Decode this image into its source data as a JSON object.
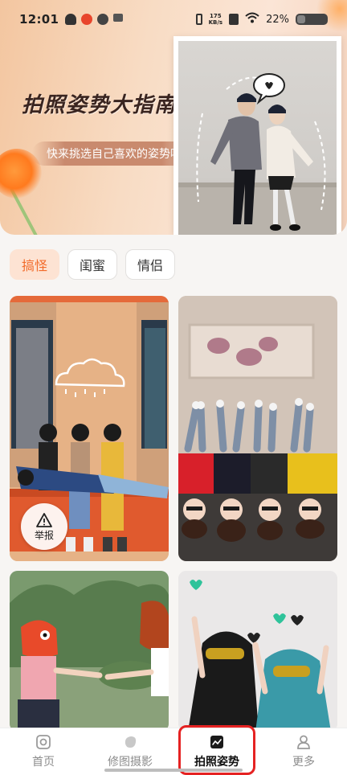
{
  "status": {
    "time": "12:01",
    "net_speed_top": "175",
    "net_speed_bottom": "KB/s",
    "battery": "22%"
  },
  "hero": {
    "title": "拍照姿势大指南",
    "subtitle": "快来挑选自己喜欢的姿势吧"
  },
  "tabs": [
    {
      "label": "搞怪",
      "active": true
    },
    {
      "label": "闺蜜",
      "active": false
    },
    {
      "label": "情侣",
      "active": false
    }
  ],
  "cards": {
    "report_label": "举报"
  },
  "bottom_nav": [
    {
      "label": "首页",
      "icon": "camera-square-icon",
      "active": false
    },
    {
      "label": "修图摄影",
      "icon": "edit-blob-icon",
      "active": false
    },
    {
      "label": "拍照姿势",
      "icon": "pose-image-icon",
      "active": true
    },
    {
      "label": "更多",
      "icon": "person-icon",
      "active": false
    }
  ],
  "colors": {
    "accent": "#f26b2a",
    "tab_active_bg": "#fde3d3",
    "highlight_outline": "#e52222"
  }
}
